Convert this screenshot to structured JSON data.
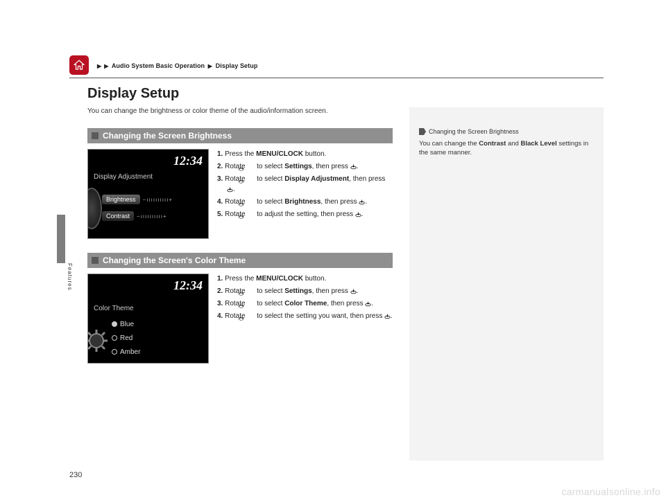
{
  "breadcrumb": {
    "part1": "Audio System Basic Operation",
    "part2": "Display Setup"
  },
  "title": "Display Setup",
  "intro": "You can change the brightness or color theme of the audio/information screen.",
  "features_tab": "Features",
  "page_number": "230",
  "watermark": "carmanualsonline.info",
  "section1": {
    "heading": "Changing the Screen Brightness",
    "screen": {
      "clock": "12:34",
      "title": "Display Adjustment",
      "row1": "Brightness",
      "row2": "Contrast",
      "slider": "−ıııııııııı+"
    },
    "steps": {
      "s1a": "1.",
      "s1b": "Press the ",
      "s1c": "MENU/CLOCK",
      "s1d": " button.",
      "s2a": "2.",
      "s2b": "Rotate ",
      "s2c": " to select ",
      "s2d": "Settings",
      "s2e": ", then press ",
      "s3a": "3.",
      "s3b": "Rotate ",
      "s3c": " to select ",
      "s3d": "Display Adjustment",
      "s3e": ", then press ",
      "s4a": "4.",
      "s4b": "Rotate ",
      "s4c": " to select ",
      "s4d": "Brightness",
      "s4e": ", then press ",
      "s5a": "5.",
      "s5b": "Rotate ",
      "s5c": " to adjust the setting, then press "
    }
  },
  "section2": {
    "heading": "Changing the Screen's Color Theme",
    "screen": {
      "clock": "12:34",
      "title": "Color Theme",
      "opt1": "Blue",
      "opt2": "Red",
      "opt3": "Amber"
    },
    "steps": {
      "s1a": "1.",
      "s1b": "Press the ",
      "s1c": "MENU/CLOCK",
      "s1d": " button.",
      "s2a": "2.",
      "s2b": "Rotate ",
      "s2c": " to select ",
      "s2d": "Settings",
      "s2e": ", then press ",
      "s3a": "3.",
      "s3b": "Rotate ",
      "s3c": " to select ",
      "s3d": "Color Theme",
      "s3e": ", then press ",
      "s4a": "4.",
      "s4b": "Rotate ",
      "s4c": " to select the setting you want, then press "
    }
  },
  "sidebar": {
    "note_head": "Changing the Screen Brightness",
    "note_body_a": "You can change the ",
    "note_body_b": "Contrast",
    "note_body_c": " and ",
    "note_body_d": "Black Level",
    "note_body_e": " settings in the same manner."
  }
}
